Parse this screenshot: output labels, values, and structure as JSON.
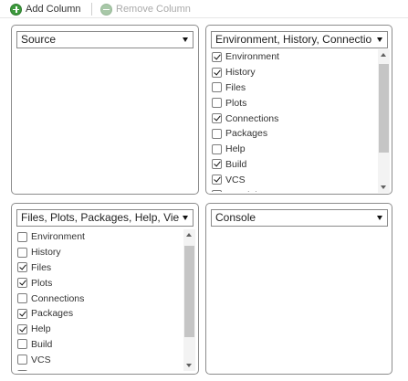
{
  "toolbar": {
    "add_label": "Add Column",
    "remove_label": "Remove Column",
    "add_icon": "add-circle-icon",
    "remove_icon": "remove-circle-icon"
  },
  "panes": {
    "top_left": {
      "selected": "Source",
      "items": []
    },
    "top_right": {
      "selected": "Environment, History, Connectio",
      "items": [
        {
          "label": "Environment",
          "checked": true
        },
        {
          "label": "History",
          "checked": true
        },
        {
          "label": "Files",
          "checked": false
        },
        {
          "label": "Plots",
          "checked": false
        },
        {
          "label": "Connections",
          "checked": true
        },
        {
          "label": "Packages",
          "checked": false
        },
        {
          "label": "Help",
          "checked": false
        },
        {
          "label": "Build",
          "checked": true
        },
        {
          "label": "VCS",
          "checked": true
        },
        {
          "label": "Tutorial",
          "checked": true
        }
      ]
    },
    "bottom_left": {
      "selected": "Files, Plots, Packages, Help, Vie",
      "items": [
        {
          "label": "Environment",
          "checked": false
        },
        {
          "label": "History",
          "checked": false
        },
        {
          "label": "Files",
          "checked": true
        },
        {
          "label": "Plots",
          "checked": true
        },
        {
          "label": "Connections",
          "checked": false
        },
        {
          "label": "Packages",
          "checked": true
        },
        {
          "label": "Help",
          "checked": true
        },
        {
          "label": "Build",
          "checked": false
        },
        {
          "label": "VCS",
          "checked": false
        },
        {
          "label": "Tutorial",
          "checked": false
        }
      ]
    },
    "bottom_right": {
      "selected": "Console",
      "items": []
    }
  }
}
